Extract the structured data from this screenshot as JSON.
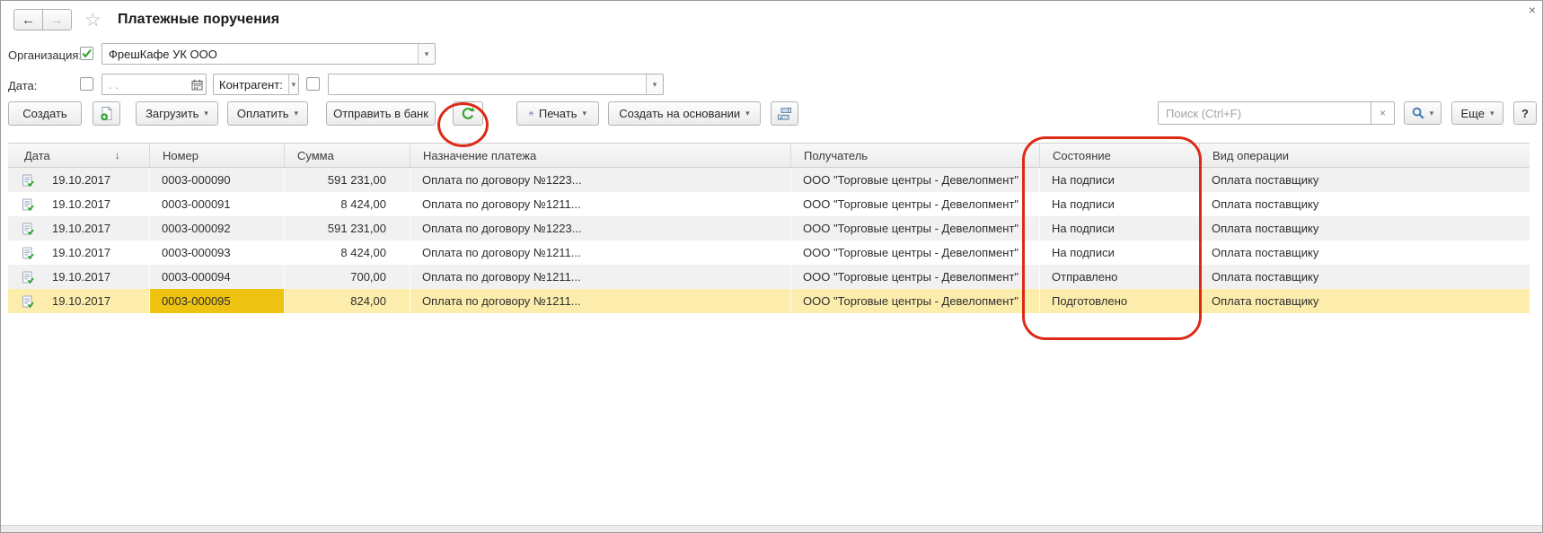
{
  "window": {
    "title": "Платежные поручения"
  },
  "icons": {
    "back": "←",
    "forward": "→",
    "star": "☆",
    "close": "×",
    "dropdown": "▾",
    "clear": "×",
    "sort_desc": "↓",
    "help": "?"
  },
  "filters": {
    "organization": {
      "label": "Организация:",
      "checked": true,
      "value": "ФрешКафе УК ООО"
    },
    "date": {
      "label": "Дата:",
      "checked": false,
      "placeholder": ". ."
    },
    "counterparty": {
      "label": "Контрагент:",
      "checked": false,
      "value": ""
    }
  },
  "toolbar": {
    "create": "Создать",
    "load": "Загрузить",
    "pay": "Оплатить",
    "send_to_bank": "Отправить в банк",
    "print": "Печать",
    "create_based_on": "Создать на основании",
    "search_placeholder": "Поиск (Ctrl+F)",
    "more": "Еще",
    "help": "?"
  },
  "table": {
    "columns": [
      "Дата",
      "Номер",
      "Сумма",
      "Назначение платежа",
      "Получатель",
      "Состояние",
      "Вид операции"
    ],
    "sorted_by": "Дата",
    "sort_direction": "desc",
    "selected_row_index": 5,
    "selected_cell": "number",
    "rows": [
      {
        "date": "19.10.2017",
        "number": "0003-000090",
        "amount": "591 231,00",
        "purpose": "Оплата по договору №1223...",
        "payee": "ООО \"Торговые центры - Девелопмент\"",
        "state": "На подписи",
        "operation": "Оплата поставщику"
      },
      {
        "date": "19.10.2017",
        "number": "0003-000091",
        "amount": "8 424,00",
        "purpose": "Оплата по договору №1211...",
        "payee": "ООО \"Торговые центры - Девелопмент\"",
        "state": "На подписи",
        "operation": "Оплата поставщику"
      },
      {
        "date": "19.10.2017",
        "number": "0003-000092",
        "amount": "591 231,00",
        "purpose": "Оплата по договору №1223...",
        "payee": "ООО \"Торговые центры - Девелопмент\"",
        "state": "На подписи",
        "operation": "Оплата поставщику"
      },
      {
        "date": "19.10.2017",
        "number": "0003-000093",
        "amount": "8 424,00",
        "purpose": "Оплата по договору №1211...",
        "payee": "ООО \"Торговые центры - Девелопмент\"",
        "state": "На подписи",
        "operation": "Оплата поставщику"
      },
      {
        "date": "19.10.2017",
        "number": "0003-000094",
        "amount": "700,00",
        "purpose": "Оплата по договору №1211...",
        "payee": "ООО \"Торговые центры - Девелопмент\"",
        "state": "Отправлено",
        "operation": "Оплата поставщику"
      },
      {
        "date": "19.10.2017",
        "number": "0003-000095",
        "amount": "824,00",
        "purpose": "Оплата по договору №1211...",
        "payee": "ООО \"Торговые центры - Девелопмент\"",
        "state": "Подготовлено",
        "operation": "Оплата поставщику"
      }
    ]
  },
  "colors": {
    "annotation_red": "#dc2a17",
    "selected_row": "#fcedad",
    "active_cell": "#efc312",
    "stripe_row": "#f1f1f1",
    "accent_green": "#2da32d"
  }
}
